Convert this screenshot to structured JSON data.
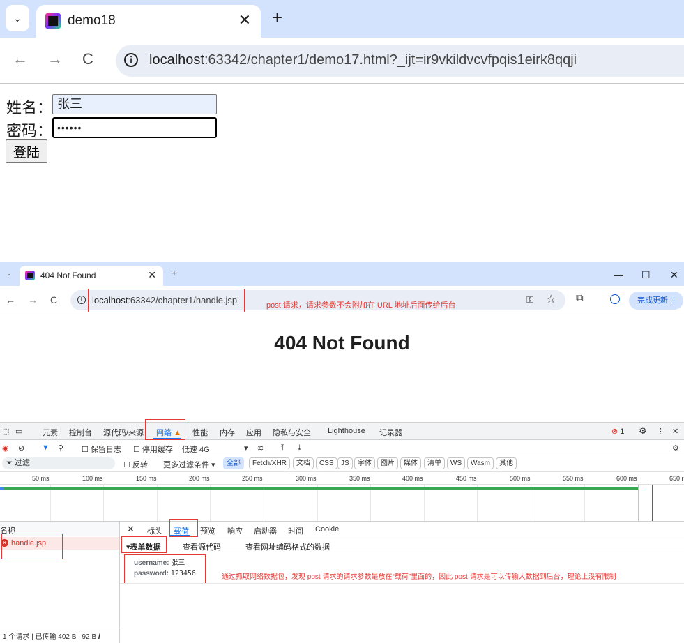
{
  "top_browser": {
    "tab_title": "demo18",
    "url_host": "localhost",
    "url_rest": ":63342/chapter1/demo17.html?_ijt=ir9vkildvcvfpqis1eirk8qqji"
  },
  "form": {
    "name_label": "姓名：",
    "name_value": "张三",
    "pwd_label": "密码：",
    "pwd_value": "••••••",
    "login_label": "登陆"
  },
  "second_browser": {
    "tab_title": "404 Not Found",
    "url_host": "localhost",
    "url_rest": ":63342/chapter1/handle.jsp",
    "update_label": "完成更新",
    "page_heading": "404 Not Found",
    "annotation": "post 请求，请求参数不会附加在 URL 地址后面传给后台"
  },
  "devtools": {
    "tabs": [
      "元素",
      "控制台",
      "源代码/来源",
      "网络",
      "性能",
      "内存",
      "应用",
      "隐私与安全",
      "Lighthouse",
      "记录器"
    ],
    "error_count": "1",
    "toolbar": {
      "preserve_log": "保留日志",
      "disable_cache": "停用缓存",
      "throttle": "低速 4G"
    },
    "filter": {
      "placeholder": "过滤",
      "invert": "反转",
      "more_filters": "更多过滤条件",
      "chips": [
        "全部",
        "Fetch/XHR",
        "文档",
        "CSS",
        "JS",
        "字体",
        "图片",
        "媒体",
        "清单",
        "WS",
        "Wasm",
        "其他"
      ]
    },
    "timeline_ticks": [
      "50 ms",
      "100 ms",
      "150 ms",
      "200 ms",
      "250 ms",
      "300 ms",
      "350 ms",
      "400 ms",
      "450 ms",
      "500 ms",
      "550 ms",
      "600 ms",
      "650 r"
    ],
    "request_list": {
      "header": "名称",
      "items": [
        "handle.jsp"
      ],
      "status": "1 个请求 | 已传输 402 B | 92 B 𝑰"
    },
    "detail_tabs": [
      "标头",
      "载荷",
      "预览",
      "响应",
      "启动器",
      "时间",
      "Cookie"
    ],
    "payload": {
      "section_title": "▾表单数据",
      "view_source": "查看源代码",
      "view_urlencoded": "查看网址编码格式的数据",
      "params": [
        {
          "key": "username:",
          "value": "张三"
        },
        {
          "key": "password:",
          "value": "123456"
        }
      ],
      "annotation": "通过抓取网络数据包，发现 post 请求的请求参数是放在“载荷”里面的，因此 post 请求是可以传输大数据到后台，理论上没有限制"
    }
  }
}
